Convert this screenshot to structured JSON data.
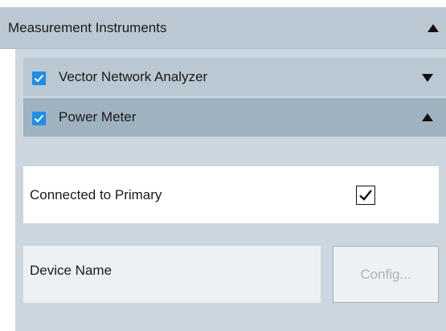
{
  "section": {
    "title": "Measurement Instruments",
    "expanded": true,
    "toggle_icon": "triangle-up-icon"
  },
  "instruments": [
    {
      "label": "Vector Network Analyzer",
      "checked": true,
      "expanded": false,
      "toggle_icon": "triangle-down-icon"
    },
    {
      "label": "Power Meter",
      "checked": true,
      "expanded": true,
      "toggle_icon": "triangle-up-icon"
    }
  ],
  "power_meter": {
    "connected_label": "Connected to Primary",
    "connected_checked": true,
    "device_name_placeholder": "Device Name",
    "device_name_value": "",
    "config_label": "Config...",
    "config_enabled": false
  },
  "colors": {
    "header_bg": "#b9c8d2",
    "selected_header_bg": "#9eb2c0",
    "panel_bg": "#ccd6de",
    "checkbox_accent": "#1e8ee8"
  }
}
